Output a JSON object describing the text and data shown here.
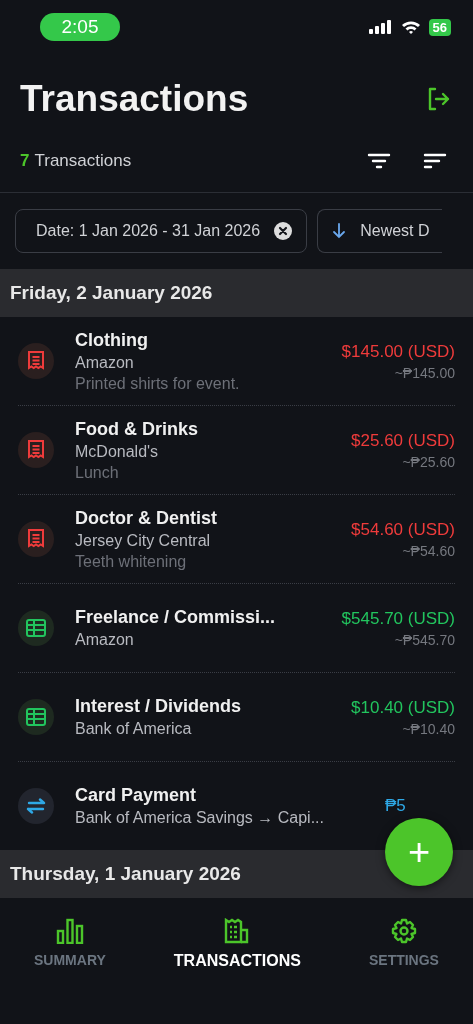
{
  "status_bar": {
    "time": "2:05",
    "battery": "56"
  },
  "header": {
    "title": "Transactions",
    "count": "7",
    "count_label": "Transactions"
  },
  "chips": [
    {
      "kind": "date",
      "label": "Date: 1 Jan 2026 - 31 Jan 2026"
    },
    {
      "kind": "sort",
      "label": "Newest D"
    }
  ],
  "groups": [
    {
      "date": "Friday, 2 January 2026",
      "transactions": [
        {
          "kind": "expense",
          "category": "Clothing",
          "payee": "Amazon",
          "note": "Printed shirts for event.",
          "amount": "$145.00 (USD)",
          "converted": "~₱145.00"
        },
        {
          "kind": "expense",
          "category": "Food & Drinks",
          "payee": "McDonald's",
          "note": "Lunch",
          "amount": "$25.60 (USD)",
          "converted": "~₱25.60"
        },
        {
          "kind": "expense",
          "category": "Doctor & Dentist",
          "payee": "Jersey City Central",
          "note": "Teeth whitening",
          "amount": "$54.60 (USD)",
          "converted": "~₱54.60"
        },
        {
          "kind": "income",
          "category": "Freelance / Commissi...",
          "payee": "Amazon",
          "amount": "$545.70 (USD)",
          "converted": "~₱545.70"
        },
        {
          "kind": "income",
          "category": "Interest / Dividends",
          "payee": "Bank of America",
          "amount": "$10.40 (USD)",
          "converted": "~₱10.40"
        },
        {
          "kind": "transfer",
          "category": "Card Payment",
          "payee": "Bank of America Savings → Capi...",
          "amount": "₱5"
        }
      ]
    },
    {
      "date": "Thursday, 1 January 2026"
    }
  ],
  "add_button": {
    "label": "+"
  },
  "nav": [
    {
      "kind": "summary",
      "label": "SUMMARY",
      "selected": false
    },
    {
      "kind": "transactions",
      "label": "TRANSACTIONS",
      "selected": true
    },
    {
      "kind": "settings",
      "label": "SETTINGS",
      "selected": false
    }
  ]
}
